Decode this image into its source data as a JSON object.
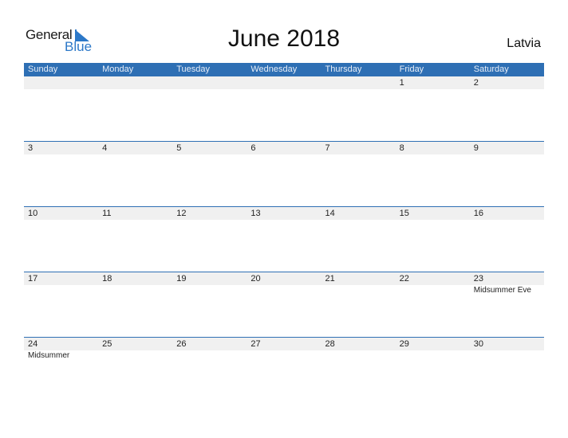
{
  "logo": {
    "word1": "General",
    "word2": "Blue"
  },
  "title": "June 2018",
  "country": "Latvia",
  "colors": {
    "header_bg": "#2e6fb4",
    "strip_bg": "#f0f0f0",
    "brand_blue": "#2c78c8"
  },
  "weekdays": [
    "Sunday",
    "Monday",
    "Tuesday",
    "Wednesday",
    "Thursday",
    "Friday",
    "Saturday"
  ],
  "weeks": [
    [
      {
        "day": ""
      },
      {
        "day": ""
      },
      {
        "day": ""
      },
      {
        "day": ""
      },
      {
        "day": ""
      },
      {
        "day": "1"
      },
      {
        "day": "2"
      }
    ],
    [
      {
        "day": "3"
      },
      {
        "day": "4"
      },
      {
        "day": "5"
      },
      {
        "day": "6"
      },
      {
        "day": "7"
      },
      {
        "day": "8"
      },
      {
        "day": "9"
      }
    ],
    [
      {
        "day": "10"
      },
      {
        "day": "11"
      },
      {
        "day": "12"
      },
      {
        "day": "13"
      },
      {
        "day": "14"
      },
      {
        "day": "15"
      },
      {
        "day": "16"
      }
    ],
    [
      {
        "day": "17"
      },
      {
        "day": "18"
      },
      {
        "day": "19"
      },
      {
        "day": "20"
      },
      {
        "day": "21"
      },
      {
        "day": "22"
      },
      {
        "day": "23",
        "event": "Midsummer Eve"
      }
    ],
    [
      {
        "day": "24",
        "event": "Midsummer"
      },
      {
        "day": "25"
      },
      {
        "day": "26"
      },
      {
        "day": "27"
      },
      {
        "day": "28"
      },
      {
        "day": "29"
      },
      {
        "day": "30"
      }
    ]
  ]
}
